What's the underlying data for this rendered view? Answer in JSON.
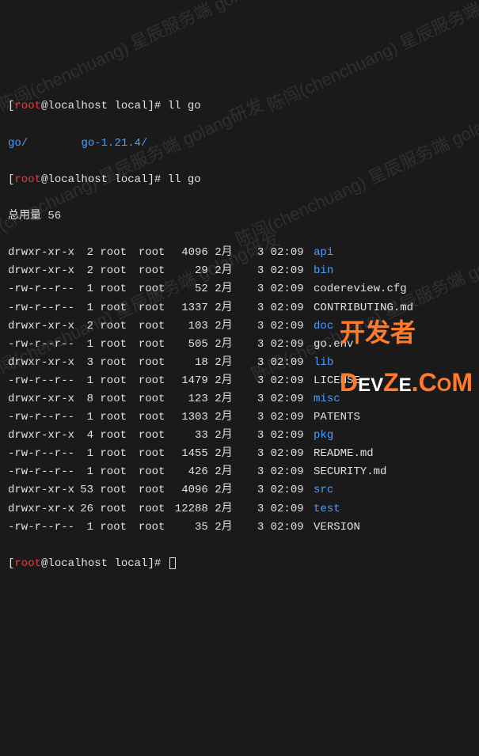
{
  "prompt": {
    "open": "[",
    "user": "root",
    "at": "@",
    "host": "localhost",
    "path": "local",
    "close": "]#"
  },
  "cmd1": "ll go",
  "completion": {
    "a": "go/",
    "b": "go-1.21.4/"
  },
  "cmd2": "ll go",
  "total_label": "总用量 56",
  "rows": [
    {
      "perms": "drwxr-xr-x",
      "links": "2",
      "owner": "root",
      "group": "root",
      "size": "4096",
      "month": "2月",
      "day": "3",
      "time": "02:09",
      "name": "api",
      "dir": true
    },
    {
      "perms": "drwxr-xr-x",
      "links": "2",
      "owner": "root",
      "group": "root",
      "size": "29",
      "month": "2月",
      "day": "3",
      "time": "02:09",
      "name": "bin",
      "dir": true
    },
    {
      "perms": "-rw-r--r--",
      "links": "1",
      "owner": "root",
      "group": "root",
      "size": "52",
      "month": "2月",
      "day": "3",
      "time": "02:09",
      "name": "codereview.cfg",
      "dir": false
    },
    {
      "perms": "-rw-r--r--",
      "links": "1",
      "owner": "root",
      "group": "root",
      "size": "1337",
      "month": "2月",
      "day": "3",
      "time": "02:09",
      "name": "CONTRIBUTING.md",
      "dir": false
    },
    {
      "perms": "drwxr-xr-x",
      "links": "2",
      "owner": "root",
      "group": "root",
      "size": "103",
      "month": "2月",
      "day": "3",
      "time": "02:09",
      "name": "doc",
      "dir": true
    },
    {
      "perms": "-rw-r--r--",
      "links": "1",
      "owner": "root",
      "group": "root",
      "size": "505",
      "month": "2月",
      "day": "3",
      "time": "02:09",
      "name": "go.env",
      "dir": false
    },
    {
      "perms": "drwxr-xr-x",
      "links": "3",
      "owner": "root",
      "group": "root",
      "size": "18",
      "month": "2月",
      "day": "3",
      "time": "02:09",
      "name": "lib",
      "dir": true
    },
    {
      "perms": "-rw-r--r--",
      "links": "1",
      "owner": "root",
      "group": "root",
      "size": "1479",
      "month": "2月",
      "day": "3",
      "time": "02:09",
      "name": "LICENSE",
      "dir": false
    },
    {
      "perms": "drwxr-xr-x",
      "links": "8",
      "owner": "root",
      "group": "root",
      "size": "123",
      "month": "2月",
      "day": "3",
      "time": "02:09",
      "name": "misc",
      "dir": true
    },
    {
      "perms": "-rw-r--r--",
      "links": "1",
      "owner": "root",
      "group": "root",
      "size": "1303",
      "month": "2月",
      "day": "3",
      "time": "02:09",
      "name": "PATENTS",
      "dir": false
    },
    {
      "perms": "drwxr-xr-x",
      "links": "4",
      "owner": "root",
      "group": "root",
      "size": "33",
      "month": "2月",
      "day": "3",
      "time": "02:09",
      "name": "pkg",
      "dir": true
    },
    {
      "perms": "-rw-r--r--",
      "links": "1",
      "owner": "root",
      "group": "root",
      "size": "1455",
      "month": "2月",
      "day": "3",
      "time": "02:09",
      "name": "README.md",
      "dir": false
    },
    {
      "perms": "-rw-r--r--",
      "links": "1",
      "owner": "root",
      "group": "root",
      "size": "426",
      "month": "2月",
      "day": "3",
      "time": "02:09",
      "name": "SECURITY.md",
      "dir": false
    },
    {
      "perms": "drwxr-xr-x",
      "links": "53",
      "owner": "root",
      "group": "root",
      "size": "4096",
      "month": "2月",
      "day": "3",
      "time": "02:09",
      "name": "src",
      "dir": true
    },
    {
      "perms": "drwxr-xr-x",
      "links": "26",
      "owner": "root",
      "group": "root",
      "size": "12288",
      "month": "2月",
      "day": "3",
      "time": "02:09",
      "name": "test",
      "dir": true
    },
    {
      "perms": "-rw-r--r--",
      "links": "1",
      "owner": "root",
      "group": "root",
      "size": "35",
      "month": "2月",
      "day": "3",
      "time": "02:09",
      "name": "VERSION",
      "dir": false
    }
  ],
  "watermark_text": "陈闯(chenchuang) 星辰服务端 golang研发",
  "logo": {
    "line1": "开发者",
    "line2a": "D",
    "line2b": "EV",
    "line2c": "Z",
    "line2d": "E",
    "line2e": ".C",
    "line2f": "O",
    "line2g": "M"
  }
}
